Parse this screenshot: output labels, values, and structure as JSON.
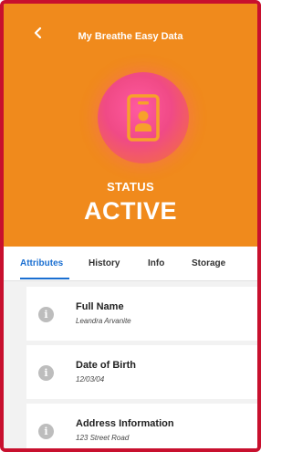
{
  "header": {
    "title": "My Breathe Easy Data",
    "status_label": "STATUS",
    "status_value": "ACTIVE",
    "back_icon": "chevron-left-icon",
    "badge_icon": "id-badge-icon"
  },
  "tabs": [
    {
      "label": "Attributes",
      "active": true
    },
    {
      "label": "History",
      "active": false
    },
    {
      "label": "Info",
      "active": false
    },
    {
      "label": "Storage",
      "active": false
    }
  ],
  "fields": [
    {
      "label": "Full Name",
      "value": "Leandra Arvanite"
    },
    {
      "label": "Date of Birth",
      "value": "12/03/04"
    },
    {
      "label": "Address Information",
      "value": "123 Street Road"
    }
  ],
  "info_icon_glyph": "i",
  "colors": {
    "header_bg": "#f08a1c",
    "frame_border": "#c8102e",
    "active_tab": "#1a6fd1"
  }
}
